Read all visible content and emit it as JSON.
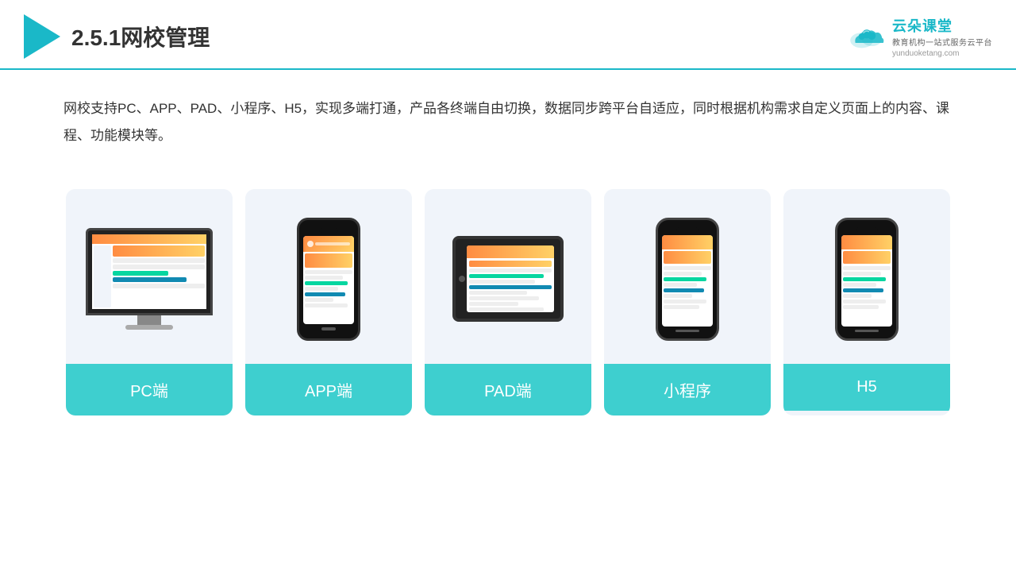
{
  "header": {
    "title": "2.5.1网校管理",
    "brand": {
      "name": "云朵课堂",
      "slogan": "教育机构一站式服务云平台",
      "url": "yunduoketang.com"
    }
  },
  "description": "网校支持PC、APP、PAD、小程序、H5，实现多端打通，产品各终端自由切换，数据同步跨平台自适应，同时根据机构需求自定义页面上的内容、课程、功能模块等。",
  "cards": [
    {
      "id": "pc",
      "label": "PC端"
    },
    {
      "id": "app",
      "label": "APP端"
    },
    {
      "id": "pad",
      "label": "PAD端"
    },
    {
      "id": "mini",
      "label": "小程序"
    },
    {
      "id": "h5",
      "label": "H5"
    }
  ]
}
